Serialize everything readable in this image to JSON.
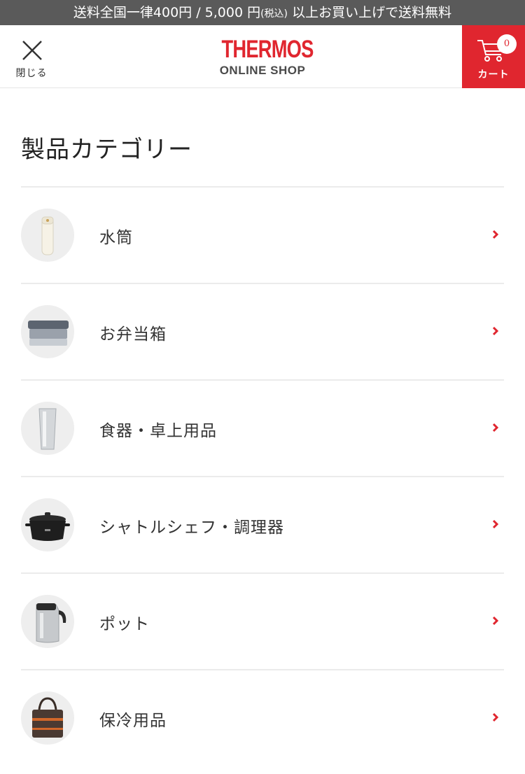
{
  "banner": {
    "part1": "送料全国一律400円 / 5,000 円",
    "part2": "(税込)",
    "part3": " 以上お買い上げで送料無料"
  },
  "header": {
    "close_label": "閉じる",
    "logo_main": "THERMOS",
    "logo_sub": "ONLINE SHOP",
    "cart_count": "0",
    "cart_label": "カート"
  },
  "section": {
    "title": "製品カテゴリー"
  },
  "categories": [
    {
      "label": "水筒",
      "icon": "water-bottle-icon"
    },
    {
      "label": "お弁当箱",
      "icon": "lunch-box-icon"
    },
    {
      "label": "食器・卓上用品",
      "icon": "tumbler-icon"
    },
    {
      "label": "シャトルシェフ・調理器",
      "icon": "cooking-pot-icon"
    },
    {
      "label": "ポット",
      "icon": "carafe-icon"
    },
    {
      "label": "保冷用品",
      "icon": "cooler-bag-icon"
    }
  ],
  "colors": {
    "accent": "#e0262f",
    "banner_bg": "#5a5a5a",
    "divider": "#ebebeb",
    "thumb_bg": "#eeeeee"
  }
}
